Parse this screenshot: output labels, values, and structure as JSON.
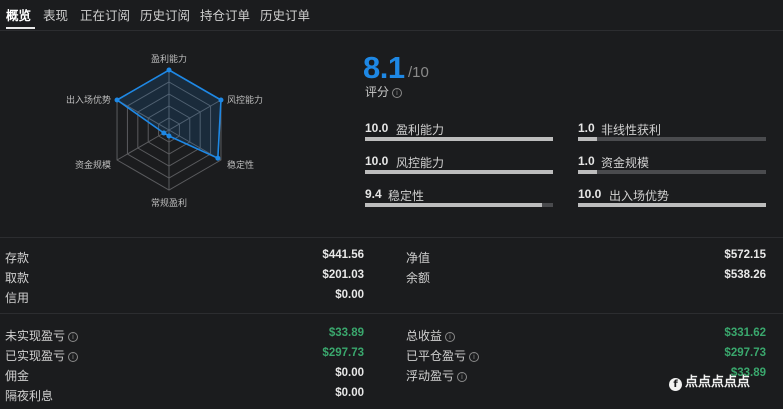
{
  "tabs": [
    "概览",
    "表现",
    "正在订阅",
    "历史订阅",
    "持仓订单",
    "历史订单"
  ],
  "radar": {
    "axes": [
      "盈利能力",
      "风控能力",
      "稳定性",
      "常规盈利",
      "资金规模",
      "出入场优势"
    ],
    "values": [
      10.0,
      10.0,
      9.4,
      1.0,
      1.0,
      10.0
    ],
    "max": 10
  },
  "score": {
    "value": "8.1",
    "denominator": "/10",
    "label": "评分"
  },
  "metrics": [
    {
      "value": "10.0",
      "label": "盈利能力",
      "fill": 1.0
    },
    {
      "value": "1.0",
      "label": "非线性获利",
      "fill": 0.1
    },
    {
      "value": "10.0",
      "label": "风控能力",
      "fill": 1.0
    },
    {
      "value": "1.0",
      "label": "资金规模",
      "fill": 0.1
    },
    {
      "value": "9.4",
      "label": "稳定性",
      "fill": 0.94
    },
    {
      "value": "10.0",
      "label": "出入场优势",
      "fill": 1.0
    }
  ],
  "account": {
    "left": [
      {
        "label": "存款",
        "value": "$441.56"
      },
      {
        "label": "取款",
        "value": "$201.03"
      },
      {
        "label": "信用",
        "value": "$0.00"
      }
    ],
    "right": [
      {
        "label": "净值",
        "value": "$572.15"
      },
      {
        "label": "余额",
        "value": "$538.26"
      }
    ]
  },
  "pnl": {
    "left": [
      {
        "label": "未实现盈亏",
        "value": "$33.89"
      },
      {
        "label": "已实现盈亏",
        "value": "$297.73"
      },
      {
        "label": "佣金",
        "value": "$0.00"
      },
      {
        "label": "隔夜利息",
        "value": "$0.00"
      }
    ],
    "right": [
      {
        "label": "总收益",
        "value": "$331.62"
      },
      {
        "label": "已平仓盈亏",
        "value": "$297.73"
      },
      {
        "label": "浮动盈亏",
        "value": "$33.89"
      }
    ]
  },
  "watermark": "点点点点点",
  "colors": {
    "accent": "#1e88e5",
    "positive": "#3aa76d",
    "background": "#1b1c1e"
  }
}
